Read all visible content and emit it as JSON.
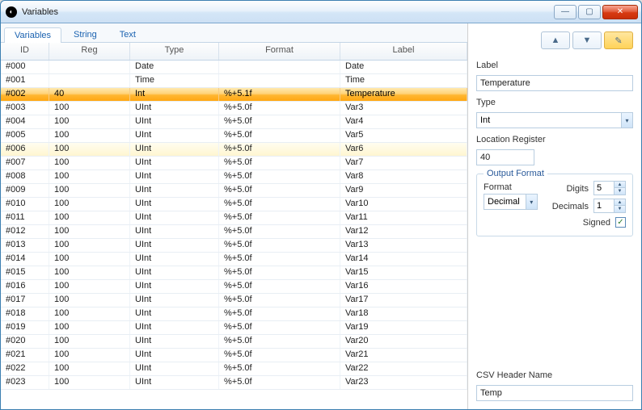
{
  "window": {
    "title": "Variables"
  },
  "tabs": [
    {
      "label": "Variables",
      "active": true
    },
    {
      "label": "String",
      "active": false
    },
    {
      "label": "Text",
      "active": false
    }
  ],
  "columns": {
    "id": "ID",
    "reg": "Reg",
    "type": "Type",
    "fmt": "Format",
    "lbl": "Label"
  },
  "rows": [
    {
      "id": "#000",
      "reg": "",
      "type": "Date",
      "fmt": "",
      "lbl": "Date"
    },
    {
      "id": "#001",
      "reg": "",
      "type": "Time",
      "fmt": "",
      "lbl": "Time"
    },
    {
      "id": "#002",
      "reg": "40",
      "type": "Int",
      "fmt": "%+5.1f",
      "lbl": "Temperature",
      "selected": true
    },
    {
      "id": "#003",
      "reg": "100",
      "type": "UInt",
      "fmt": "%+5.0f",
      "lbl": "Var3"
    },
    {
      "id": "#004",
      "reg": "100",
      "type": "UInt",
      "fmt": "%+5.0f",
      "lbl": "Var4"
    },
    {
      "id": "#005",
      "reg": "100",
      "type": "UInt",
      "fmt": "%+5.0f",
      "lbl": "Var5"
    },
    {
      "id": "#006",
      "reg": "100",
      "type": "UInt",
      "fmt": "%+5.0f",
      "lbl": "Var6",
      "hov": true
    },
    {
      "id": "#007",
      "reg": "100",
      "type": "UInt",
      "fmt": "%+5.0f",
      "lbl": "Var7"
    },
    {
      "id": "#008",
      "reg": "100",
      "type": "UInt",
      "fmt": "%+5.0f",
      "lbl": "Var8"
    },
    {
      "id": "#009",
      "reg": "100",
      "type": "UInt",
      "fmt": "%+5.0f",
      "lbl": "Var9"
    },
    {
      "id": "#010",
      "reg": "100",
      "type": "UInt",
      "fmt": "%+5.0f",
      "lbl": "Var10"
    },
    {
      "id": "#011",
      "reg": "100",
      "type": "UInt",
      "fmt": "%+5.0f",
      "lbl": "Var11"
    },
    {
      "id": "#012",
      "reg": "100",
      "type": "UInt",
      "fmt": "%+5.0f",
      "lbl": "Var12"
    },
    {
      "id": "#013",
      "reg": "100",
      "type": "UInt",
      "fmt": "%+5.0f",
      "lbl": "Var13"
    },
    {
      "id": "#014",
      "reg": "100",
      "type": "UInt",
      "fmt": "%+5.0f",
      "lbl": "Var14"
    },
    {
      "id": "#015",
      "reg": "100",
      "type": "UInt",
      "fmt": "%+5.0f",
      "lbl": "Var15"
    },
    {
      "id": "#016",
      "reg": "100",
      "type": "UInt",
      "fmt": "%+5.0f",
      "lbl": "Var16"
    },
    {
      "id": "#017",
      "reg": "100",
      "type": "UInt",
      "fmt": "%+5.0f",
      "lbl": "Var17"
    },
    {
      "id": "#018",
      "reg": "100",
      "type": "UInt",
      "fmt": "%+5.0f",
      "lbl": "Var18"
    },
    {
      "id": "#019",
      "reg": "100",
      "type": "UInt",
      "fmt": "%+5.0f",
      "lbl": "Var19"
    },
    {
      "id": "#020",
      "reg": "100",
      "type": "UInt",
      "fmt": "%+5.0f",
      "lbl": "Var20"
    },
    {
      "id": "#021",
      "reg": "100",
      "type": "UInt",
      "fmt": "%+5.0f",
      "lbl": "Var21"
    },
    {
      "id": "#022",
      "reg": "100",
      "type": "UInt",
      "fmt": "%+5.0f",
      "lbl": "Var22"
    },
    {
      "id": "#023",
      "reg": "100",
      "type": "UInt",
      "fmt": "%+5.0f",
      "lbl": "Var23"
    }
  ],
  "side": {
    "label_lbl": "Label",
    "label_val": "Temperature",
    "type_lbl": "Type",
    "type_val": "Int",
    "locreg_lbl": "Location Register",
    "locreg_val": "40",
    "outfmt_lbl": "Output Format",
    "format_lbl": "Format",
    "format_val": "Decimal",
    "digits_lbl": "Digits",
    "digits_val": "5",
    "decimals_lbl": "Decimals",
    "decimals_val": "1",
    "signed_lbl": "Signed",
    "csvhdr_lbl": "CSV Header Name",
    "csvhdr_val": "Temp"
  },
  "glyphs": {
    "up": "▲",
    "down": "▼",
    "check": "✓",
    "pencil": "✎",
    "min": "—",
    "max": "▢",
    "close": "✕",
    "dd": "▾"
  }
}
